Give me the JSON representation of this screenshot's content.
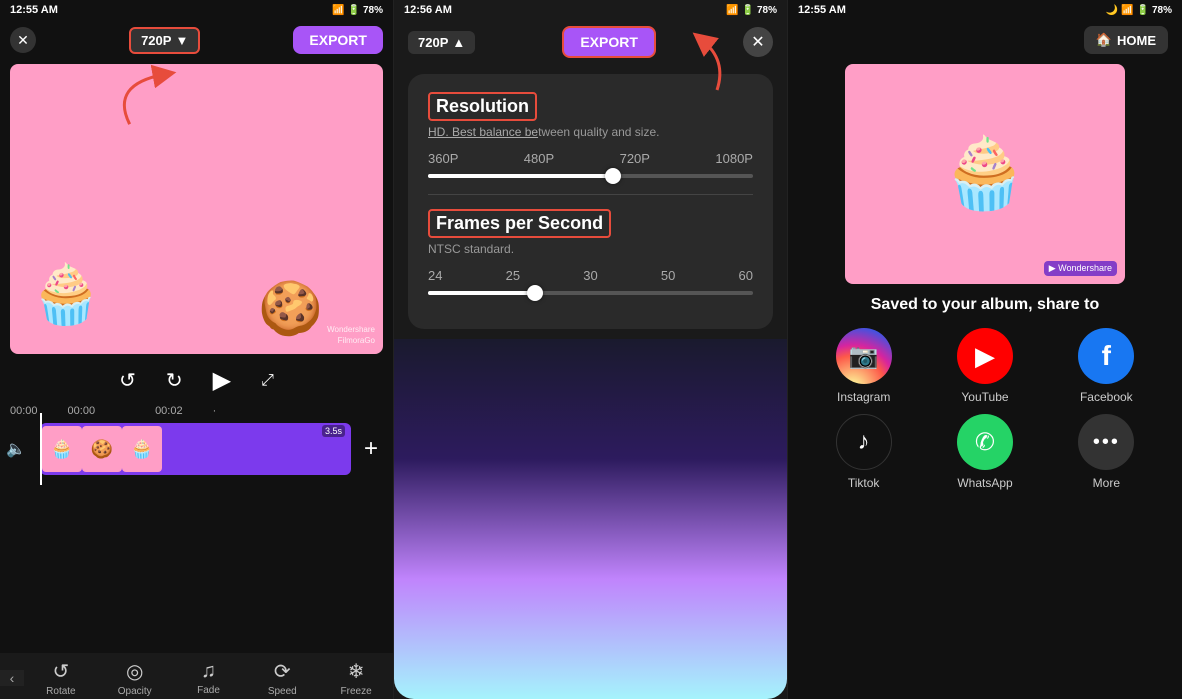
{
  "panel1": {
    "status": {
      "time": "12:55 AM",
      "battery": "78%",
      "wifi": "WiFi",
      "signal": "●●●"
    },
    "resolution_badge": "720P",
    "export_label": "EXPORT",
    "video_bg": "#ff9ec6",
    "chars": [
      "🧁",
      "🍪"
    ],
    "watermark": "Wondershare\nFilmoraGo",
    "timeline": {
      "markers": [
        "00:00",
        "00:00",
        "00:02"
      ],
      "duration_label": "3.5s"
    },
    "tools": [
      {
        "label": "Rotate",
        "icon": "↺"
      },
      {
        "label": "Opacity",
        "icon": "◎"
      },
      {
        "label": "Fade",
        "icon": "♪"
      },
      {
        "label": "Speed",
        "icon": "⟳"
      },
      {
        "label": "Freeze",
        "icon": "❄"
      }
    ]
  },
  "panel2": {
    "status": {
      "time": "12:56 AM",
      "battery": "78%"
    },
    "resolution_badge": "720P",
    "export_label": "EXPORT",
    "close_label": "✕",
    "settings": {
      "resolution": {
        "title": "Resolution",
        "subtitle_normal": "HD. Best balance be",
        "subtitle_underlined": "tween quality and size.",
        "options": [
          "360P",
          "480P",
          "720P",
          "1080P"
        ],
        "slider_pct": 57
      },
      "fps": {
        "title": "Frames per Second",
        "subtitle": "NTSC standard.",
        "options": [
          "24",
          "25",
          "30",
          "50",
          "60"
        ],
        "slider_pct": 33
      }
    }
  },
  "panel3": {
    "status": {
      "time": "12:55 AM",
      "battery": "78%"
    },
    "home_label": "HOME",
    "video_bg": "#ff9ec6",
    "char": "🧁",
    "watermark": "Wondershare",
    "share_label": "Saved to your album, share to",
    "share_items": [
      {
        "label": "Instagram",
        "icon": "📷",
        "bg_class": "instagram-bg"
      },
      {
        "label": "YouTube",
        "icon": "▶",
        "bg_class": "youtube-bg"
      },
      {
        "label": "Facebook",
        "icon": "f",
        "bg_class": "facebook-bg"
      },
      {
        "label": "Tiktok",
        "icon": "♪",
        "bg_class": "tiktok-bg"
      },
      {
        "label": "WhatsApp",
        "icon": "✆",
        "bg_class": "whatsapp-bg"
      },
      {
        "label": "More",
        "icon": "•••",
        "bg_class": "more-bg"
      }
    ]
  }
}
